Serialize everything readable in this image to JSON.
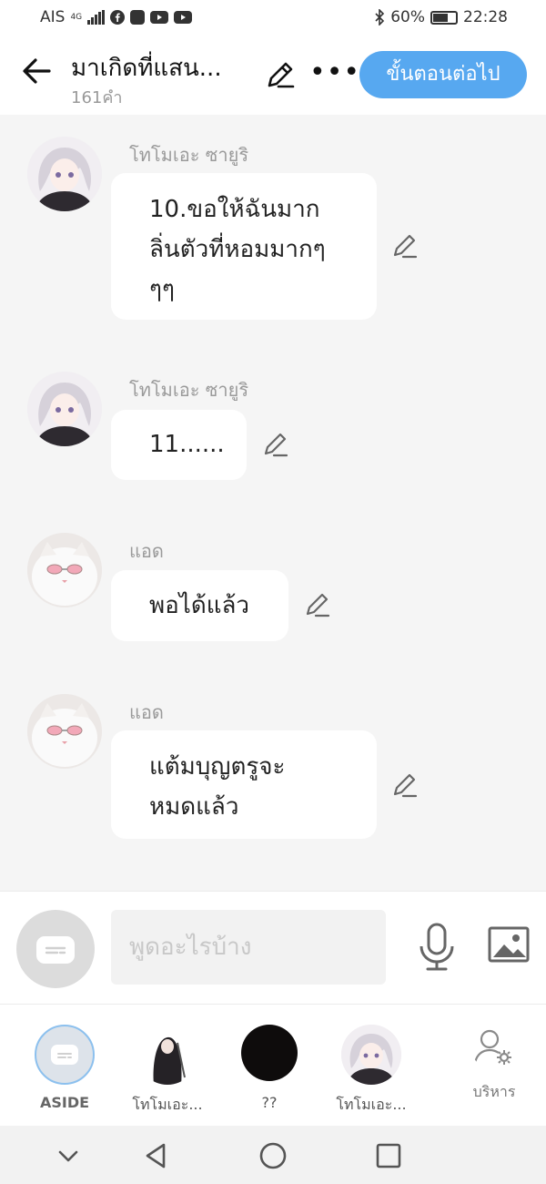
{
  "status_bar": {
    "carrier": "AIS",
    "network": "4G",
    "battery": "60%",
    "time": "22:28",
    "icons": [
      "signal-icon",
      "facebook-icon",
      "app-icon",
      "youtube-icon",
      "youtube-icon",
      "bluetooth-icon",
      "battery-icon"
    ]
  },
  "header": {
    "back_icon": "back-arrow-icon",
    "title": "มาเกิดที่แสน...",
    "word_count": "161คำ",
    "edit_icon": "pencil-icon",
    "more_icon": "more-dots-icon",
    "next_label": "ขั้นตอนต่อไป",
    "accent_color": "#57a8f0"
  },
  "messages": [
    {
      "sender": "โทโมเอะ ซายูริ",
      "avatar": "girl-avatar",
      "text": "10.ขอให้ฉันมาก\nลิ่นตัวที่หอมมากๆ\nๆๆ"
    },
    {
      "sender": "โทโมเอะ ซายูริ",
      "avatar": "girl-avatar",
      "text": "11......"
    },
    {
      "sender": "แอด",
      "avatar": "cat-avatar",
      "text": "พอได้แล้ว"
    },
    {
      "sender": "แอด",
      "avatar": "cat-avatar",
      "text": "แต้มบุญตรูจะ\nหมดแล้ว"
    }
  ],
  "input": {
    "placeholder": "พูดอะไรบ้าง",
    "mic_icon": "microphone-icon",
    "image_icon": "image-icon"
  },
  "characters": [
    {
      "name": "ASIDE",
      "icon": "aside-chat-icon"
    },
    {
      "name": "โทโมเอะ...",
      "icon": "dark-hair-avatar"
    },
    {
      "name": "??",
      "icon": "black-circle-avatar"
    },
    {
      "name": "โทโมเอะ...",
      "icon": "girl-avatar"
    },
    {
      "name": "บริหาร",
      "icon": "user-settings-icon"
    }
  ],
  "nav": [
    "chevron-down-icon",
    "back-triangle-icon",
    "home-circle-icon",
    "recents-square-icon"
  ]
}
